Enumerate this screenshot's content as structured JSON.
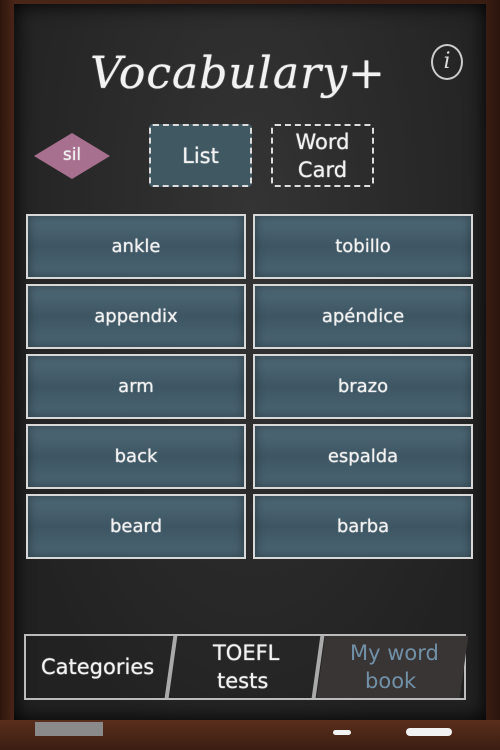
{
  "app": {
    "title": "Vocabulary+",
    "info_icon": "info-icon"
  },
  "language_badge": "sil",
  "modes": {
    "list": "List",
    "card_line1": "Word",
    "card_line2": "Card",
    "selected": "List"
  },
  "words": [
    {
      "en": "ankle",
      "es": "tobillo"
    },
    {
      "en": "appendix",
      "es": "apéndice"
    },
    {
      "en": "arm",
      "es": "brazo"
    },
    {
      "en": "back",
      "es": "espalda"
    },
    {
      "en": "beard",
      "es": "barba"
    }
  ],
  "tabs": [
    {
      "line1": "Categories",
      "line2": ""
    },
    {
      "line1": "TOEFL",
      "line2": "tests"
    },
    {
      "line1": "My word",
      "line2": "book"
    }
  ],
  "colors": {
    "board": "#262626",
    "cell": "#46606f",
    "badge": "#a7708f",
    "inactive_tab_text": "#7191a8"
  }
}
